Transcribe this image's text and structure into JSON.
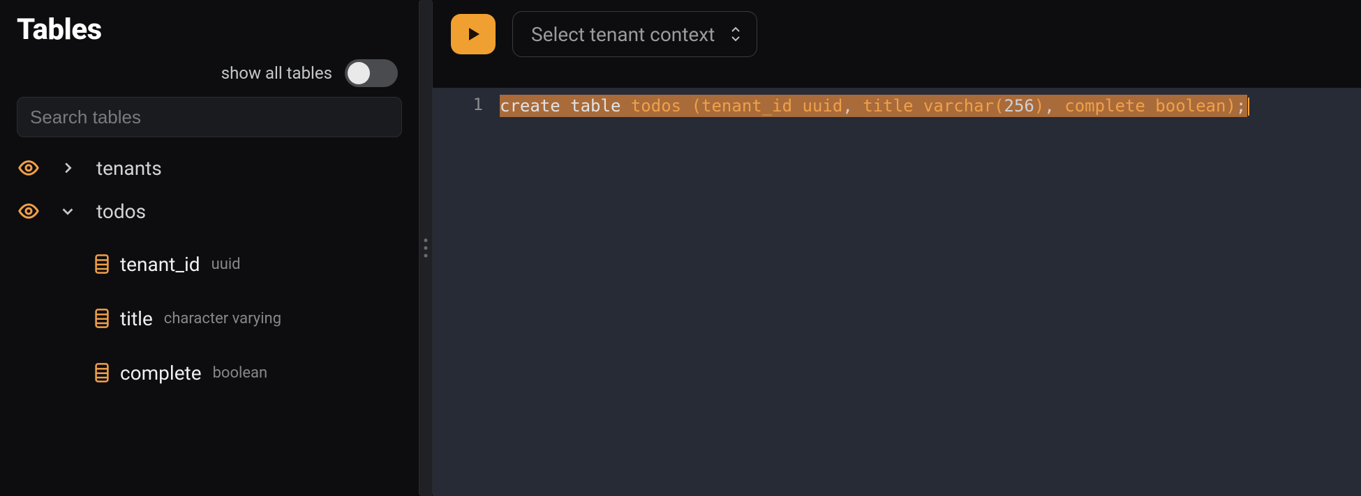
{
  "sidebar": {
    "title": "Tables",
    "show_all_label": "show all tables",
    "search_placeholder": "Search tables",
    "tables": [
      {
        "name": "tenants",
        "expanded": false
      },
      {
        "name": "todos",
        "expanded": true,
        "columns": [
          {
            "name": "tenant_id",
            "type": "uuid"
          },
          {
            "name": "title",
            "type": "character varying"
          },
          {
            "name": "complete",
            "type": "boolean"
          }
        ]
      }
    ]
  },
  "toolbar": {
    "tenant_select_placeholder": "Select tenant context"
  },
  "editor": {
    "line_number": "1",
    "tokens": {
      "kw_create": "create",
      "kw_table": "table",
      "ident_todos": "todos",
      "lparen": "(",
      "col1": "tenant_id",
      "type1": "uuid",
      "comma1": ",",
      "col2": "title",
      "type2": "varchar",
      "lparen2": "(",
      "num": "256",
      "rparen2": ")",
      "comma2": ",",
      "col3": "complete",
      "type3": "boolean",
      "rparen": ")",
      "semi": ";"
    }
  },
  "colors": {
    "accent": "#f0a030",
    "bg_editor": "#272b36",
    "highlight": "#a96b3a"
  }
}
